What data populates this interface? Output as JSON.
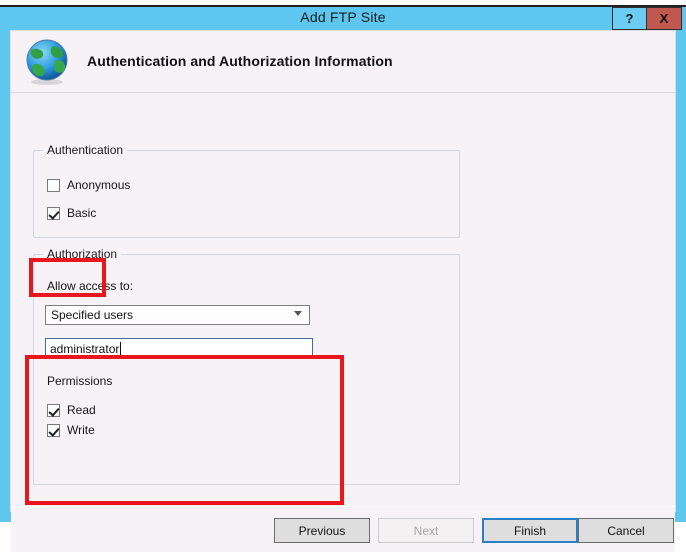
{
  "background": {
    "sliver_text": "..."
  },
  "window": {
    "title": "Add FTP Site",
    "help_label": "?",
    "close_label": "X",
    "accent_color": "#5dc7ef",
    "close_color": "#c0584f"
  },
  "header": {
    "caption": "Authentication and Authorization Information",
    "icon": "globe-icon"
  },
  "authentication": {
    "legend": "Authentication",
    "options": [
      {
        "label": "Anonymous",
        "checked": false
      },
      {
        "label": "Basic",
        "checked": true
      }
    ]
  },
  "authorization": {
    "legend": "Authorization",
    "allow_access_label": "Allow access to:",
    "allow_access_value": "Specified users",
    "users_value": "administrator",
    "users_placeholder": "",
    "permissions_label": "Permissions",
    "permissions": [
      {
        "label": "Read",
        "checked": true
      },
      {
        "label": "Write",
        "checked": true
      }
    ]
  },
  "annotations": {
    "color": "#e8161d",
    "boxes": [
      {
        "name": "basic-highlight"
      },
      {
        "name": "authorization-highlight"
      }
    ]
  },
  "footer": {
    "previous_label": "Previous",
    "next_label": "Next",
    "finish_label": "Finish",
    "cancel_label": "Cancel"
  }
}
